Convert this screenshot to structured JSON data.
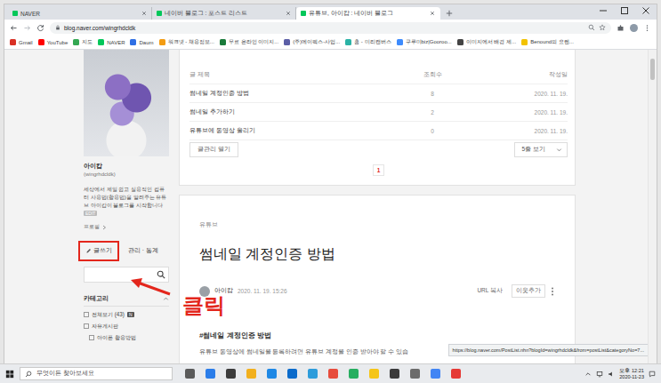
{
  "browser": {
    "tabs": [
      {
        "label": "NAVER",
        "selected": false
      },
      {
        "label": "네이버 블로그 : 포스트 리스트",
        "selected": false
      },
      {
        "label": "유튜브, 아이캅 : 네이버 블로그",
        "selected": true
      }
    ],
    "url": "blog.naver.com/wingrhdcldk",
    "bookmarks": [
      {
        "label": "Gmail",
        "color": "#d93025"
      },
      {
        "label": "YouTube",
        "color": "#ff0000"
      },
      {
        "label": "지도",
        "color": "#34a853"
      },
      {
        "label": "NAVER",
        "color": "#03c75a"
      },
      {
        "label": "Daum",
        "color": "#2f6fe4"
      },
      {
        "label": "워크넷 - 채용정보...",
        "color": "#f39c12"
      },
      {
        "label": "무료 온라인 이미지...",
        "color": "#1a7a3a"
      },
      {
        "label": "(주)에이펙스-사업...",
        "color": "#5b5ea6"
      },
      {
        "label": "홈 - 미리캔버스",
        "color": "#2bb3a6"
      },
      {
        "label": "구루미biz|Gooroo...",
        "color": "#3d8bfd"
      },
      {
        "label": "이미지에서 배경 제...",
        "color": "#444444"
      },
      {
        "label": "Benound의 요렌...",
        "color": "#f2c200"
      }
    ],
    "status_url": "https://blog.naver.com/PostList.nhn?blogId=wingrhdcldk&from=postList&categoryNo=7..."
  },
  "profile": {
    "name": "아이캅",
    "id": "(wingrhdcldk)",
    "description": "세상에서 제일 쉽고 실용적인 컴퓨터 사용법(활용법)을 알려주는 유튜브 아이캅이 블로그를 시작합니다",
    "badge": "EDIT",
    "link": "프로필"
  },
  "actions": [
    {
      "label": "글쓰기",
      "highlighted": true
    },
    {
      "label": "관리 · 통계",
      "highlighted": false
    }
  ],
  "annotation": {
    "text": "클릭"
  },
  "categories": {
    "title": "카테고리",
    "expanded": true,
    "items": [
      {
        "label": "전체보기 (43)",
        "badge": "N",
        "kind": "all"
      },
      {
        "label": "자유게시판",
        "kind": "board"
      },
      {
        "label": "아이폰 활용방법",
        "kind": "sub"
      }
    ]
  },
  "post_list": {
    "columns": [
      {
        "label": "글 제목"
      },
      {
        "label": "조회수"
      },
      {
        "label": "작성일"
      }
    ],
    "rows": [
      {
        "title": "썸네일 계정인증 방법",
        "views": "8",
        "date": "2020. 11. 19."
      },
      {
        "title": "썸네일 추가하기",
        "views": "2",
        "date": "2020. 11. 19."
      },
      {
        "title": "유튜브에 동영상 올리기",
        "views": "0",
        "date": "2020. 11. 19."
      }
    ],
    "manage_button": "글관리 열기",
    "rows_select": "5줄 보기",
    "pages": [
      {
        "label": "1",
        "selected": true
      }
    ]
  },
  "post": {
    "category": "유튜브",
    "title": "썸네일 계정인증 방법",
    "author": "아이캅",
    "date": "2020. 11. 19. 15:26",
    "buttons": [
      "URL 복사",
      "이웃추가"
    ],
    "hashtag": "#썸네일 계정인증 방법",
    "body": "유튜브 동영상에 썸네일을 등록하려면 유튜브 계정을 인증 받아야 할 수 있습"
  },
  "taskbar": {
    "search_placeholder": "무엇이든 찾아보세요",
    "time": "오후 12:21",
    "date": "2020-11-23"
  },
  "scrollbar": {
    "level": 0.07
  }
}
